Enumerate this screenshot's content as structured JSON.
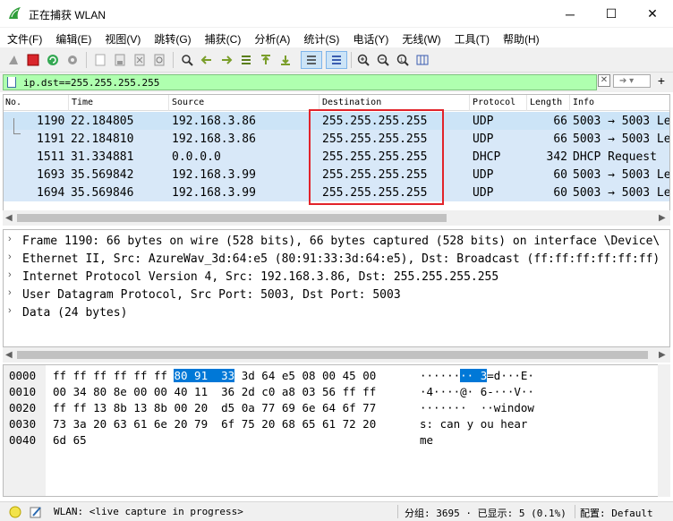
{
  "window": {
    "title": "正在捕获 WLAN",
    "min": "─",
    "max": "☐",
    "close": "✕"
  },
  "menu": [
    "文件(F)",
    "编辑(E)",
    "视图(V)",
    "跳转(G)",
    "捕获(C)",
    "分析(A)",
    "统计(S)",
    "电话(Y)",
    "无线(W)",
    "工具(T)",
    "帮助(H)"
  ],
  "filter": {
    "value": "ip.dst==255.255.255.255",
    "apply_arrow": "➔",
    "add": "+",
    "clear": "✕"
  },
  "columns": [
    "No.",
    "Time",
    "Source",
    "Destination",
    "Protocol",
    "Length",
    "Info"
  ],
  "packets": [
    {
      "no": "1190",
      "time": "22.184805",
      "src": "192.168.3.86",
      "dst": "255.255.255.255",
      "proto": "UDP",
      "len": "66",
      "info": "5003 → 5003 Le"
    },
    {
      "no": "1191",
      "time": "22.184810",
      "src": "192.168.3.86",
      "dst": "255.255.255.255",
      "proto": "UDP",
      "len": "66",
      "info": "5003 → 5003 Le"
    },
    {
      "no": "1511",
      "time": "31.334881",
      "src": "0.0.0.0",
      "dst": "255.255.255.255",
      "proto": "DHCP",
      "len": "342",
      "info": "DHCP Request"
    },
    {
      "no": "1693",
      "time": "35.569842",
      "src": "192.168.3.99",
      "dst": "255.255.255.255",
      "proto": "UDP",
      "len": "60",
      "info": "5003 → 5003 Le"
    },
    {
      "no": "1694",
      "time": "35.569846",
      "src": "192.168.3.99",
      "dst": "255.255.255.255",
      "proto": "UDP",
      "len": "60",
      "info": "5003 → 5003 Le"
    }
  ],
  "details": [
    "Frame 1190: 66 bytes on wire (528 bits), 66 bytes captured (528 bits) on interface \\Device\\",
    "Ethernet II, Src: AzureWav_3d:64:e5 (80:91:33:3d:64:e5), Dst: Broadcast (ff:ff:ff:ff:ff:ff)",
    "Internet Protocol Version 4, Src: 192.168.3.86, Dst: 255.255.255.255",
    "User Datagram Protocol, Src Port: 5003, Dst Port: 5003",
    "Data (24 bytes)"
  ],
  "bytes": [
    {
      "off": "0000",
      "hex_a": "ff ff ff ff ff ff",
      "hex_hl": "80 91  33",
      "hex_b": " 3d 64 e5 08 00 45 00",
      "asc_a": "······",
      "asc_hl": "··",
      "asc_hl2": "3",
      "asc_b": "=d···E·"
    },
    {
      "off": "0010",
      "hex": "00 34 80 8e 00 00 40 11  36 2d c0 a8 03 56 ff ff",
      "asc": "·4····@· 6-···V··"
    },
    {
      "off": "0020",
      "hex": "ff ff 13 8b 13 8b 00 20  d5 0a 77 69 6e 64 6f 77",
      "asc": "·······  ··window"
    },
    {
      "off": "0030",
      "hex": "73 3a 20 63 61 6e 20 79  6f 75 20 68 65 61 72 20",
      "asc": "s: can y ou hear "
    },
    {
      "off": "0040",
      "hex": "6d 65",
      "asc": "me"
    }
  ],
  "status": {
    "capture": "WLAN: <live capture in progress>",
    "groups": "分组: 3695 · 已显示: 5 (0.1%)",
    "profile": "配置: Default"
  },
  "colors": {
    "filter_ok": "#afffaf",
    "row_bg": "#d8e8f8",
    "selected": "#0078d7",
    "annotation": "#e2232a"
  }
}
